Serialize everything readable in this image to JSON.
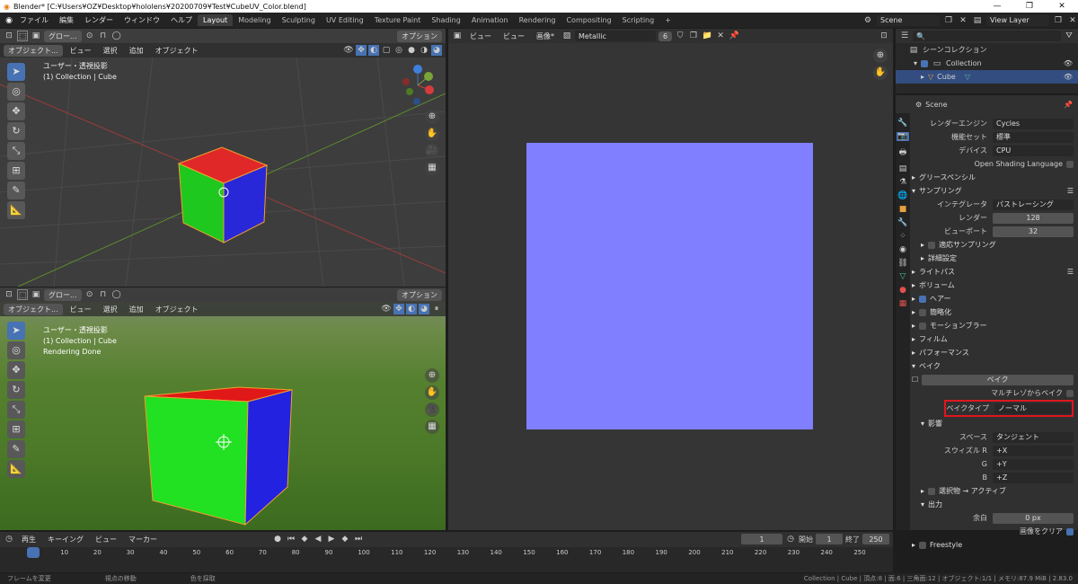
{
  "title": "Blender* [C:¥Users¥OZ¥Desktop¥hololens¥20200709¥Test¥CubeUV_Color.blend]",
  "menu": [
    "ファイル",
    "編集",
    "レンダー",
    "ウィンドウ",
    "ヘルプ"
  ],
  "workspaces": [
    "Layout",
    "Modeling",
    "Sculpting",
    "UV Editing",
    "Texture Paint",
    "Shading",
    "Animation",
    "Rendering",
    "Compositing",
    "Scripting"
  ],
  "scene_name": "Scene",
  "view_layer": "View Layer",
  "viewport_top": {
    "mode": "オブジェクト...",
    "menus": [
      "ビュー",
      "選択",
      "追加",
      "オブジェクト"
    ],
    "transform": "グロー...",
    "options": "オプション",
    "info1": "ユーザー・透視投影",
    "info2": "(1) Collection | Cube"
  },
  "viewport_bottom": {
    "mode": "オブジェクト...",
    "menus": [
      "ビュー",
      "選択",
      "追加",
      "オブジェクト"
    ],
    "transform": "グロー...",
    "options": "オプション",
    "info1": "ユーザー・透視投影",
    "info2": "(1) Collection | Cube",
    "info3": "Rendering Done"
  },
  "image_editor": {
    "view": "ビュー",
    "view2": "ビュー",
    "image_menu": "画像*",
    "image_name": "Metallic",
    "users": "6",
    "image_color": "#7f7fff"
  },
  "outliner": {
    "scene_collection": "シーンコレクション",
    "collection": "Collection",
    "cube": "Cube"
  },
  "props": {
    "scene_header": "Scene",
    "render_engine_label": "レンダーエンジン",
    "render_engine": "Cycles",
    "feature_set_label": "機能セット",
    "feature_set": "標準",
    "device_label": "デバイス",
    "device": "CPU",
    "osl": "Open Shading Language",
    "grease_pencil": "グリースペンシル",
    "sampling": "サンプリング",
    "integrator_label": "インテグレータ",
    "integrator": "パストレーシング",
    "render_label": "レンダー",
    "render_samples": "128",
    "viewport_label": "ビューポート",
    "viewport_samples": "32",
    "adaptive": "適応サンプリング",
    "advanced": "詳細設定",
    "light_paths": "ライトパス",
    "volumes": "ボリューム",
    "hair": "ヘアー",
    "simplify": "簡略化",
    "motion_blur": "モーションブラー",
    "film": "フィルム",
    "performance": "パフォーマンス",
    "bake": "ベイク",
    "bake_button": "ベイク",
    "multires": "マルチレゾからベイク",
    "bake_type_label": "ベイクタイプ",
    "bake_type": "ノーマル",
    "influence": "影響",
    "space_label": "スペース",
    "space": "タンジェント",
    "swizzle_r_label": "スウィズル R",
    "swizzle_r": "+X",
    "g_label": "G",
    "swizzle_g": "+Y",
    "b_label": "B",
    "swizzle_b": "+Z",
    "selected_to_active": "選択物 → アクティブ",
    "output": "出力",
    "margin_label": "余白",
    "margin": "0 px",
    "clear_image": "画像をクリア",
    "freestyle": "Freestyle",
    "highlight_color": "#e0161e"
  },
  "timeline": {
    "playback": "再生",
    "keying": "キーイング",
    "view": "ビュー",
    "marker": "マーカー",
    "current_frame": "1",
    "start_label": "開始",
    "start": "1",
    "end_label": "終了",
    "end": "250",
    "ticks": [
      "1",
      "10",
      "20",
      "30",
      "40",
      "50",
      "60",
      "70",
      "80",
      "90",
      "100",
      "110",
      "120",
      "130",
      "140",
      "150",
      "160",
      "170",
      "180",
      "190",
      "200",
      "210",
      "220",
      "230",
      "240",
      "250"
    ]
  },
  "status": {
    "left1": "フレームを変更",
    "left2": "視点の移動",
    "left3": "色を採取",
    "right": "Collection | Cube | 頂点:8 | 面:6 | 三角面:12 | オブジェクト:1/1 | メモリ:87.9 MiB | 2.83.0"
  }
}
